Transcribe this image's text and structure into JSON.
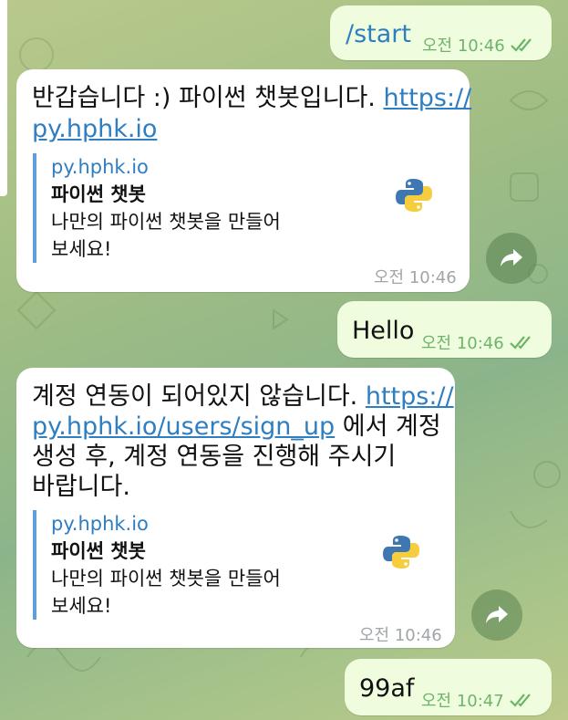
{
  "messages": {
    "m1": {
      "text": "/start",
      "time": "오전 10:46"
    },
    "m2": {
      "line1": "반갑습니다 :) 파이썬 챗봇입니다. ",
      "link1": "https://",
      "link2": "py.hphk.io",
      "preview": {
        "site": "py.hphk.io",
        "title": "파이썬 챗봇",
        "desc1": "나만의 파이썬 챗봇을 만들어",
        "desc2": "보세요!"
      },
      "time": "오전 10:46"
    },
    "m3": {
      "text": "Hello",
      "time": "오전 10:46"
    },
    "m4": {
      "line1": "계정 연동이 되어있지 않습니다. ",
      "link1": "https://",
      "link2": "py.hphk.io/users/sign_up",
      "line2_rest": " 에서 계정",
      "line3": "생성 후, 계정 연동을 진행해 주시기",
      "line4": "바랍니다.",
      "preview": {
        "site": "py.hphk.io",
        "title": "파이썬 챗봇",
        "desc1": "나만의 파이썬 챗봇을 만들어",
        "desc2": "보세요!"
      },
      "time": "오전 10:46"
    },
    "m5": {
      "text": "99af",
      "time": "오전 10:47"
    }
  },
  "colors": {
    "outgoing_bubble": "#effdde",
    "incoming_bubble": "#ffffff",
    "link": "#2f7ec2",
    "read_check": "#6db46b"
  },
  "icons": {
    "read_status": "double-check-icon",
    "forward": "share-icon",
    "preview_logo": "python-logo-icon"
  }
}
